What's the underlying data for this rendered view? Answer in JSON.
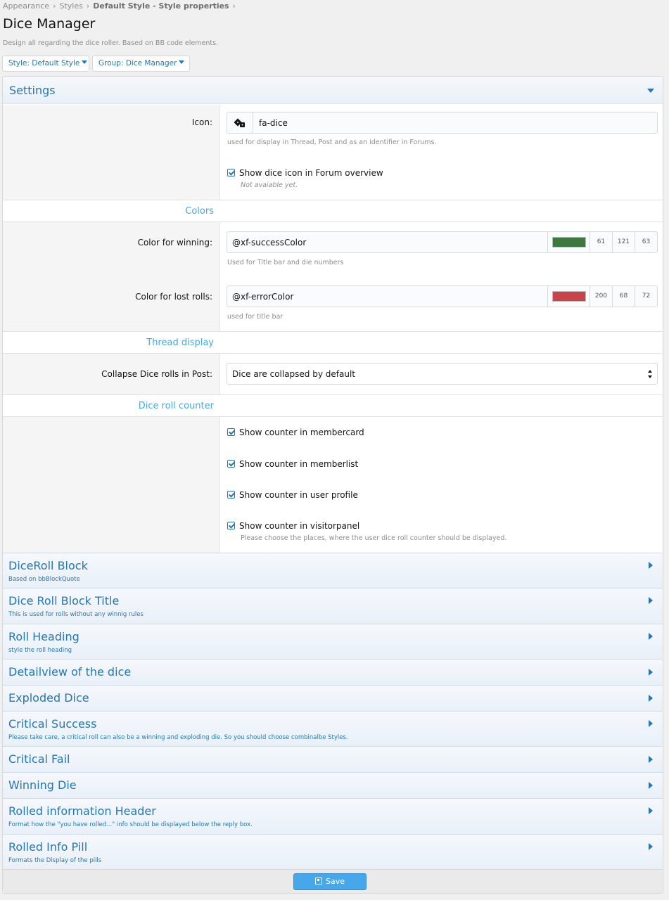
{
  "breadcrumb": {
    "items": [
      "Appearance",
      "Styles"
    ],
    "current": "Default Style - Style properties",
    "separator": "›"
  },
  "page": {
    "title": "Dice Manager",
    "description": "Design all regarding the dice roller. Based on BB code elements."
  },
  "filters": {
    "style": "Style: Default Style",
    "group": "Group: Dice Manager"
  },
  "settings": {
    "title": "Settings",
    "icon_label": "Icon:",
    "icon_value": "fa-dice",
    "icon_explain": "used for display in Thread, Post and as an identifier in Forums.",
    "show_icon_label": "Show dice icon in Forum overview",
    "show_icon_hint": "Not avaiable yet.",
    "colors_head": "Colors",
    "win_label": "Color for winning:",
    "win_value": "@xf-successColor",
    "win_rgb": [
      "61",
      "121",
      "63"
    ],
    "win_color": "#3d793f",
    "win_explain": "Used for Title bar and die numbers",
    "lost_label": "Color for lost rolls:",
    "lost_value": "@xf-errorColor",
    "lost_rgb": [
      "200",
      "68",
      "72"
    ],
    "lost_color": "#c84448",
    "lost_explain": "used for title bar",
    "thread_head": "Thread display",
    "collapse_label": "Collapse Dice rolls in Post:",
    "collapse_value": "Dice are collapsed by default",
    "counter_head": "Dice roll counter",
    "counter_options": [
      "Show counter in membercard",
      "Show counter in memberlist",
      "Show counter in user profile",
      "Show counter in visitorpanel"
    ],
    "counter_hint": "Please choose the places, where the user dice roll counter should be displayed."
  },
  "groups": [
    {
      "title": "DiceRoll Block",
      "desc": "Based on bbBlockQuote"
    },
    {
      "title": "Dice Roll Block Title",
      "desc": "This is used for rolls without any winnig rules"
    },
    {
      "title": "Roll Heading",
      "desc": "style the roll heading"
    },
    {
      "title": "Detailview of the dice",
      "desc": ""
    },
    {
      "title": "Exploded Dice",
      "desc": ""
    },
    {
      "title": "Critical Success",
      "desc": "Please take care, a critical roll can also be a winning and exploding die. So you should choose combinalbe Styles."
    },
    {
      "title": "Critical Fail",
      "desc": ""
    },
    {
      "title": "Winning Die",
      "desc": ""
    },
    {
      "title": "Rolled information Header",
      "desc": "Format how the \"you have rolled...\" info should be displayed below the reply box."
    },
    {
      "title": "Rolled Info Pill",
      "desc": "Formats the Display of the pills"
    }
  ],
  "footer": {
    "save_label": "Save"
  },
  "icons": {
    "dice": "dice-icon",
    "save": "save-icon"
  },
  "colors": {
    "accent": "#2577b1",
    "section_head": "#47a7eb",
    "button": "#47a7eb"
  }
}
